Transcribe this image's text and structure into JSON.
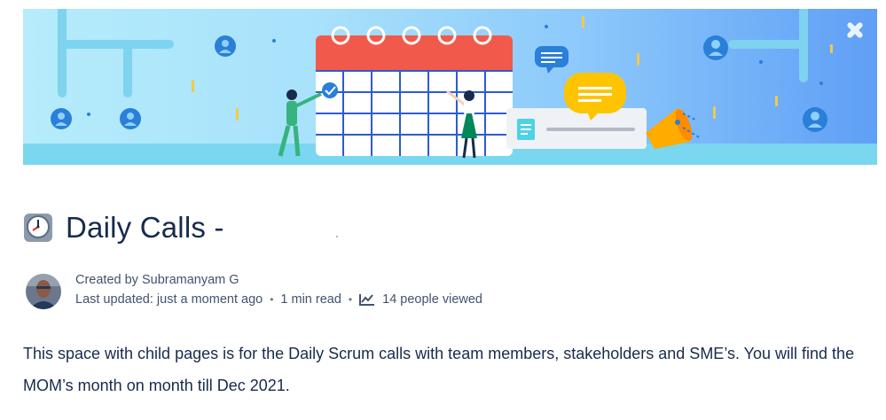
{
  "page": {
    "title": "Daily Calls -",
    "title_emoji": "clock-icon"
  },
  "byline": {
    "created_by": "Created by Subramanyam G",
    "last_updated": "Last updated: just a moment ago",
    "read_time": "1 min read",
    "views": "14 people viewed",
    "separator": "•"
  },
  "content": {
    "paragraph": "This space with child pages is for the Daily Scrum calls with team members, stakeholders and SME’s. You will find the MOM’s month on month till Dec 2021."
  },
  "colors": {
    "banner_light": "#b6ecfb",
    "banner_dark": "#5f9ff6",
    "calendar_header": "#f15a4a",
    "text_primary": "#172b4d",
    "text_secondary": "#42526e"
  }
}
